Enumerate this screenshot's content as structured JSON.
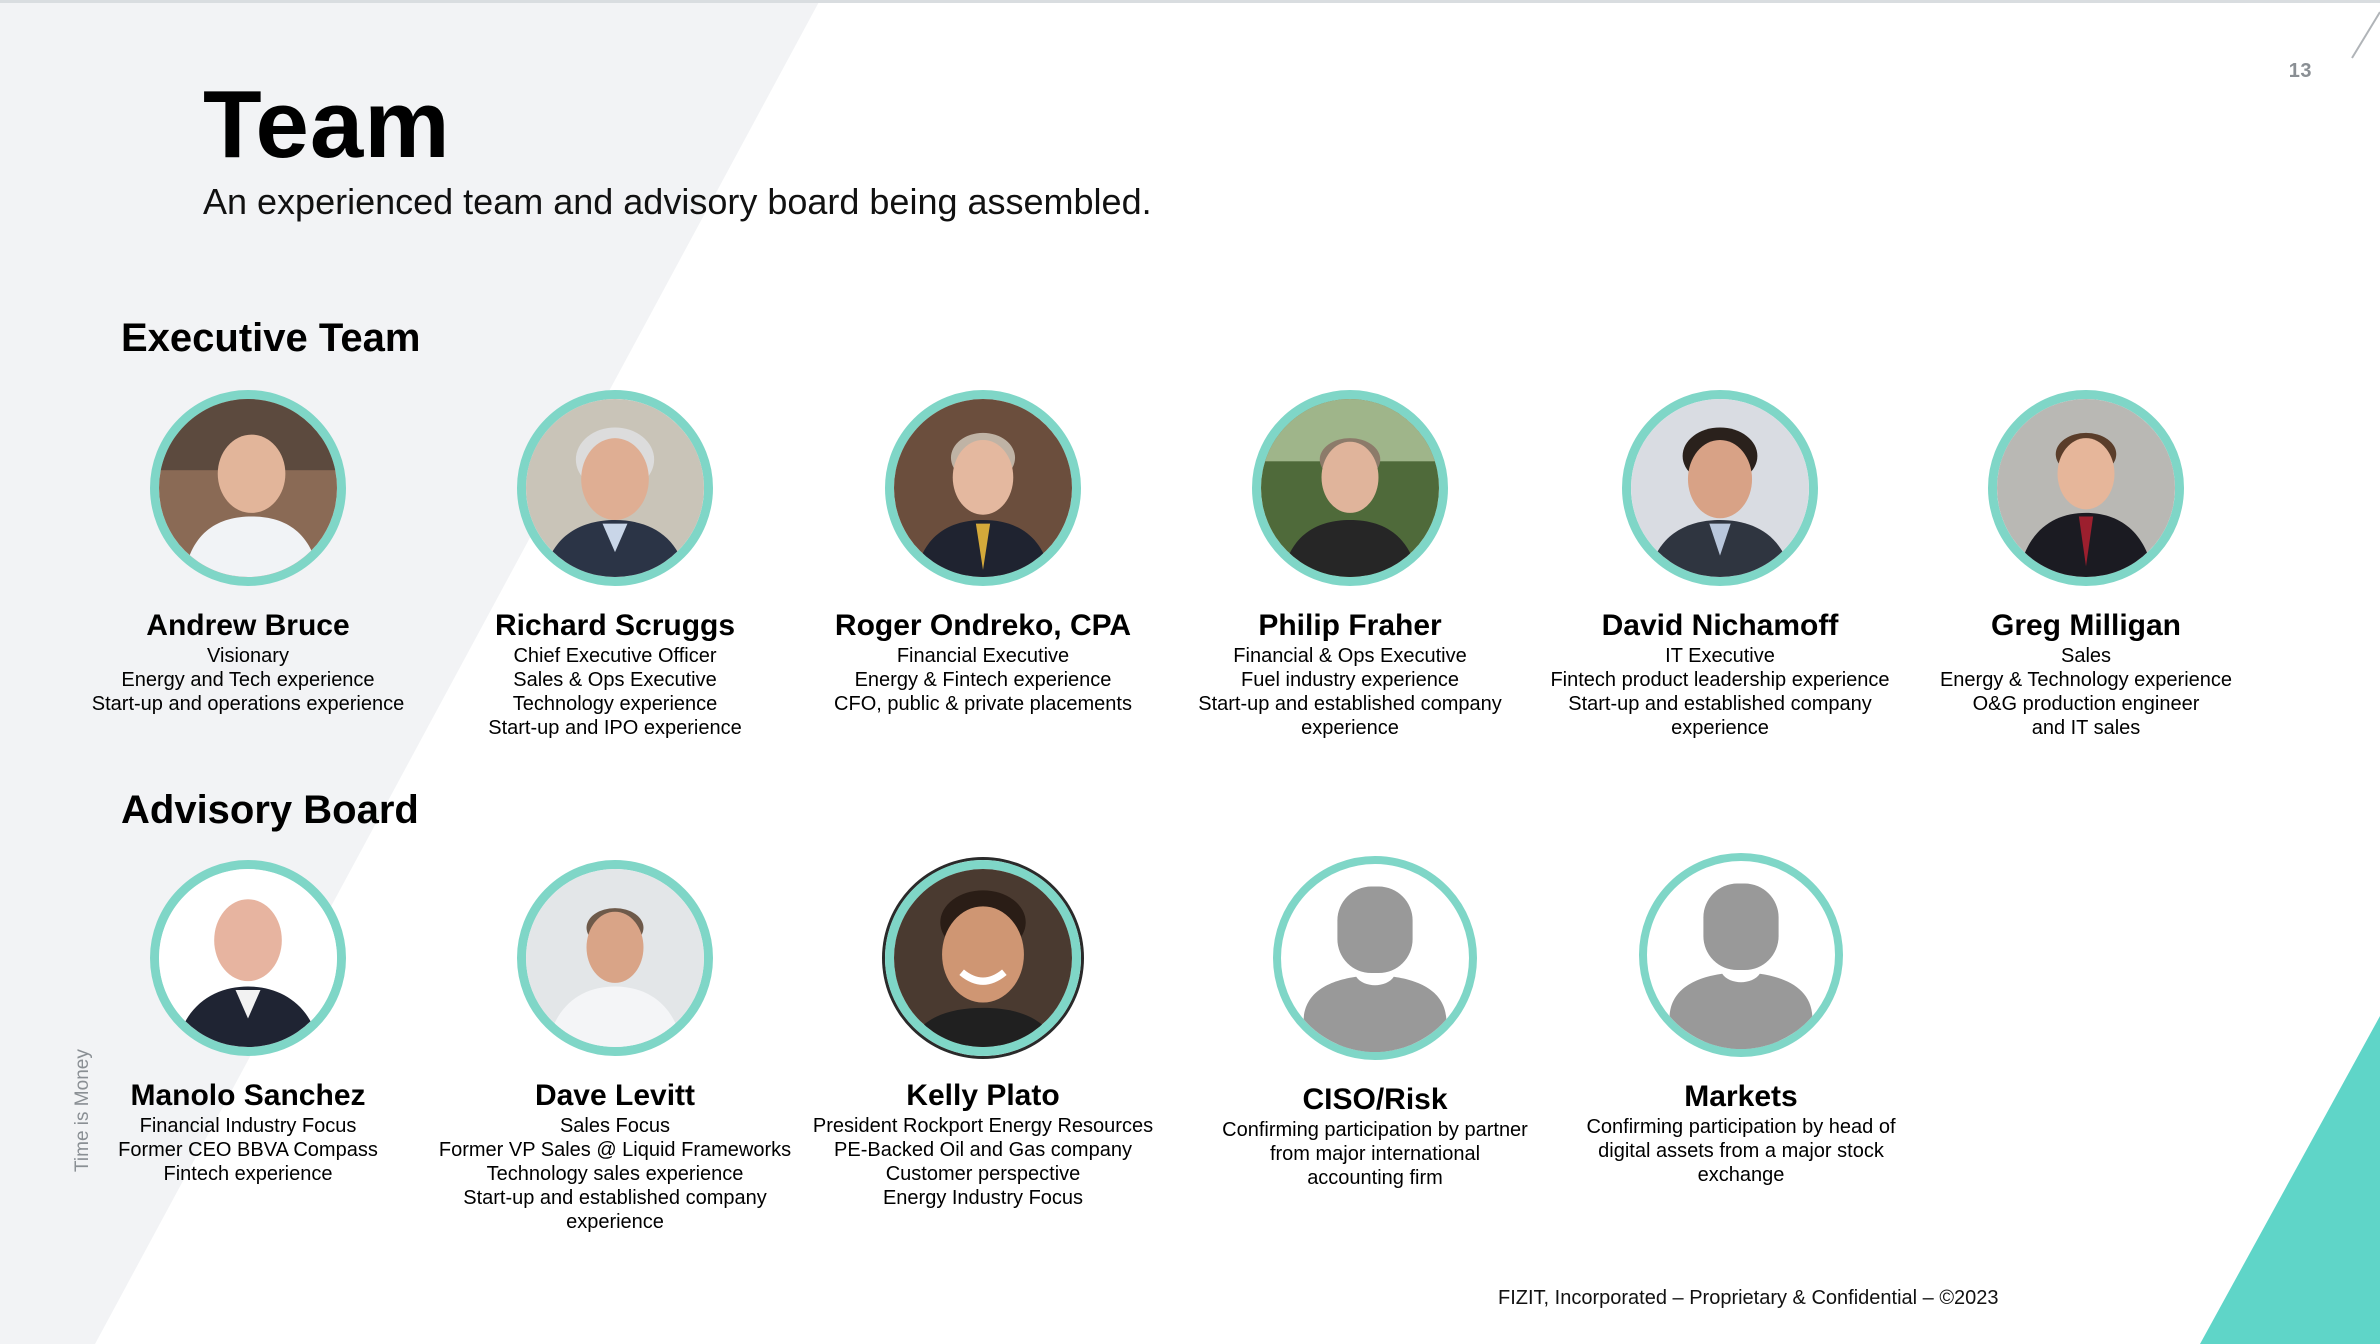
{
  "page_number": "13",
  "title": "Team",
  "subtitle": "An experienced team and advisory board being assembled.",
  "colors": {
    "ring": "#7fd6c7",
    "accent_teal": "#5fd5c8",
    "bg_shape": "#f2f3f5",
    "placeholder_gray": "#999999"
  },
  "executive": {
    "heading": "Executive Team",
    "members": [
      {
        "name": "Andrew Bruce",
        "lines": [
          "Visionary",
          "Energy and Tech experience",
          "Start-up and operations experience"
        ]
      },
      {
        "name": "Richard Scruggs",
        "lines": [
          "Chief Executive Officer",
          "Sales & Ops Executive",
          "Technology experience",
          "Start-up and IPO experience"
        ]
      },
      {
        "name": "Roger Ondreko, CPA",
        "lines": [
          "Financial Executive",
          "Energy & Fintech experience",
          "CFO, public & private placements"
        ]
      },
      {
        "name": "Philip Fraher",
        "lines": [
          "Financial & Ops Executive",
          "Fuel industry experience",
          "Start-up and established company",
          "experience"
        ]
      },
      {
        "name": "David Nichamoff",
        "lines": [
          "IT Executive",
          "Fintech product leadership experience",
          "Start-up and established company",
          "experience"
        ]
      },
      {
        "name": "Greg Milligan",
        "lines": [
          "Sales",
          "Energy & Technology experience",
          "O&G production engineer",
          "and IT sales"
        ]
      }
    ]
  },
  "advisory": {
    "heading": "Advisory Board",
    "members": [
      {
        "name": "Manolo Sanchez",
        "lines": [
          "Financial Industry Focus",
          "Former CEO BBVA Compass",
          "Fintech experience"
        ]
      },
      {
        "name": "Dave Levitt",
        "lines": [
          "Sales Focus",
          "Former VP Sales @ Liquid Frameworks",
          "Technology sales experience",
          "Start-up and established company",
          "experience"
        ]
      },
      {
        "name": "Kelly Plato",
        "lines": [
          "President Rockport Energy Resources",
          "PE-Backed Oil and Gas company",
          "Customer perspective",
          "Energy Industry Focus"
        ]
      },
      {
        "name": "CISO/Risk",
        "lines": [
          "Confirming participation by partner",
          "from major international",
          "accounting firm"
        ]
      },
      {
        "name": "Markets",
        "lines": [
          "Confirming participation by head of",
          "digital assets from a major stock",
          "exchange"
        ]
      }
    ]
  },
  "side_label": "Time is Money",
  "footer": "FIZIT, Incorporated – Proprietary & Confidential – ©2023"
}
